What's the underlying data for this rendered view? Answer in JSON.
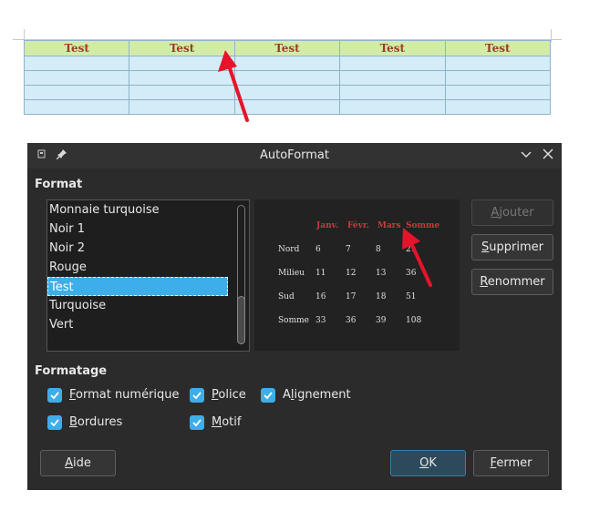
{
  "document": {
    "table_headers": [
      "Test",
      "Test",
      "Test",
      "Test",
      "Test"
    ],
    "empty_rows": 4
  },
  "dialog": {
    "title": "AutoFormat",
    "format_label": "Format",
    "format_list": [
      "Monnaie turquoise",
      "Noir 1",
      "Noir 2",
      "Rouge",
      "Test",
      "Turquoise",
      "Vert"
    ],
    "selected": "Test",
    "preview": {
      "columns": [
        "Janv.",
        "Févr.",
        "Mars",
        "Somme"
      ],
      "rows": [
        {
          "label": "Nord",
          "values": [
            "6",
            "7",
            "8",
            "21"
          ]
        },
        {
          "label": "Milieu",
          "values": [
            "11",
            "12",
            "13",
            "36"
          ]
        },
        {
          "label": "Sud",
          "values": [
            "16",
            "17",
            "18",
            "51"
          ]
        },
        {
          "label": "Somme",
          "values": [
            "33",
            "36",
            "39",
            "108"
          ]
        }
      ]
    },
    "buttons": {
      "add_first": "A",
      "add_rest": "jouter",
      "delete_first": "S",
      "delete_rest": "upprimer",
      "rename_first": "R",
      "rename_rest": "enommer",
      "help_first": "A",
      "help_rest": "ide",
      "ok_first": "O",
      "ok_rest": "K",
      "close_first": "F",
      "close_rest": "ermer"
    },
    "formatting_label": "Formatage",
    "checks": {
      "number_first": "F",
      "number_rest": "ormat numérique",
      "font_first": "P",
      "font_rest": "olice",
      "align_pre": "A",
      "align_ul": "l",
      "align_rest": "ignement",
      "borders_first": "B",
      "borders_rest": "ordures",
      "pattern_first": "M",
      "pattern_rest": "otif"
    }
  },
  "colors": {
    "accent": "#3daee9",
    "header_fill": "#d2eca8",
    "cell_fill": "#d3ecf7",
    "header_text": "#9e3a2c",
    "preview_header": "#c93a3a",
    "arrow": "#e8132a"
  },
  "icons": [
    "dialog-app-icon",
    "pin-icon",
    "chevron-down-icon",
    "close-icon",
    "checkmark-icon",
    "red-arrow-icon"
  ]
}
